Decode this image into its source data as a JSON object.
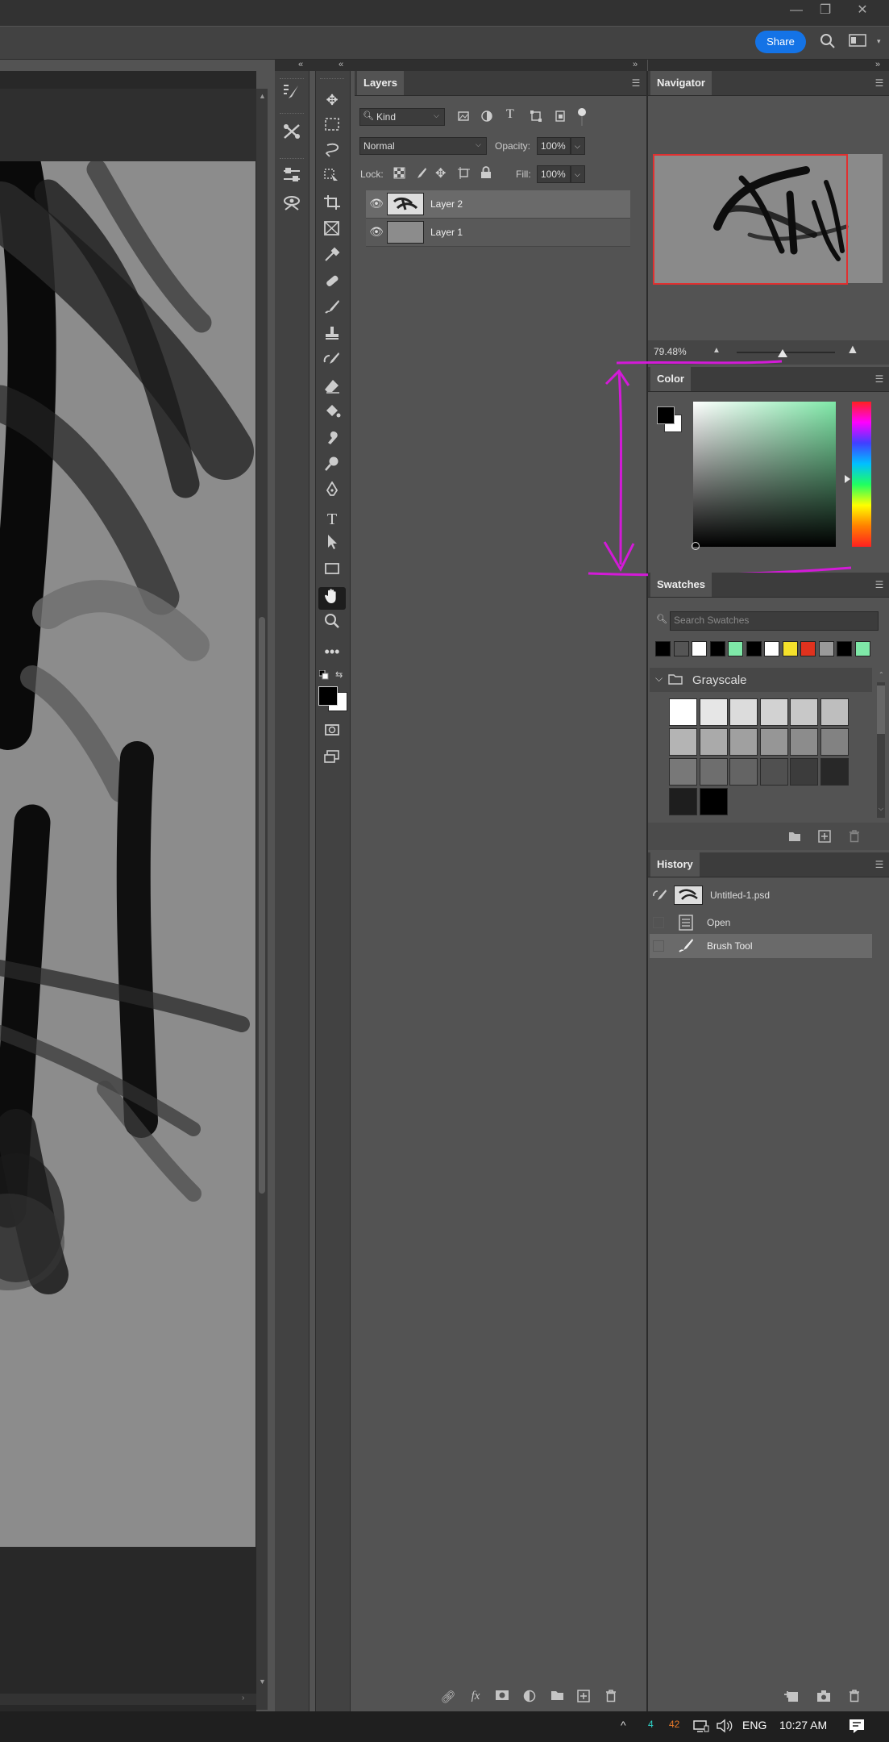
{
  "window": {
    "controls": {
      "minimize": "—",
      "restore": "❐",
      "close": "✕"
    }
  },
  "topbar": {
    "share_label": "Share",
    "search_icon": "search-icon",
    "workspace_icon": "workspace-icon"
  },
  "collapse": {
    "left": "«",
    "right": "»"
  },
  "layers": {
    "tab": "Layers",
    "filter_kind": "Kind",
    "blend_mode": "Normal",
    "opacity_label": "Opacity:",
    "opacity_value": "100%",
    "lock_label": "Lock:",
    "fill_label": "Fill:",
    "fill_value": "100%",
    "items": [
      {
        "name": "Layer 2",
        "selected": true
      },
      {
        "name": "Layer 1",
        "selected": false
      }
    ],
    "footer_icons": [
      "link-icon",
      "fx-icon",
      "mask-icon",
      "adjustment-icon",
      "folder-icon",
      "new-layer-icon",
      "trash-icon"
    ],
    "fx_label": "fx"
  },
  "navigator": {
    "tab": "Navigator",
    "zoom": "79.48%",
    "zoom_level": 0.6
  },
  "color": {
    "tab": "Color",
    "foreground": "#000000",
    "background": "#ffffff"
  },
  "swatches": {
    "tab": "Swatches",
    "search_placeholder": "Search Swatches",
    "recent": [
      "#000000",
      "#555555",
      "#ffffff",
      "#000000",
      "#7fe8a8",
      "#000000",
      "#ffffff",
      "#f5e12b",
      "#e0321e",
      "#9a9a9a",
      "#000000",
      "#7fe8a8"
    ],
    "group_name": "Grayscale",
    "grayscale": [
      "#ffffff",
      "#e6e6e6",
      "#dcdcdc",
      "#d2d2d2",
      "#c8c8c8",
      "#bebebe",
      "#b4b4b4",
      "#aaaaaa",
      "#a0a0a0",
      "#969696",
      "#8c8c8c",
      "#828282",
      "#787878",
      "#6e6e6e",
      "#646464",
      "#505050",
      "#3c3c3c",
      "#282828",
      "#1e1e1e",
      "#000000"
    ]
  },
  "history": {
    "tab": "History",
    "snapshot": "Untitled-1.psd",
    "items": [
      {
        "label": "Open",
        "icon": "document-icon"
      },
      {
        "label": "Brush Tool",
        "icon": "brush-icon",
        "selected": true
      }
    ]
  },
  "taskbar": {
    "chevron": "^",
    "badge_a": "4",
    "badge_b": "42",
    "language": "ENG",
    "time": "10:27 AM",
    "badge_a_color": "#2fd3c9",
    "badge_b_color": "#e87a2a"
  },
  "annotation": {
    "color": "#d31ad8"
  }
}
